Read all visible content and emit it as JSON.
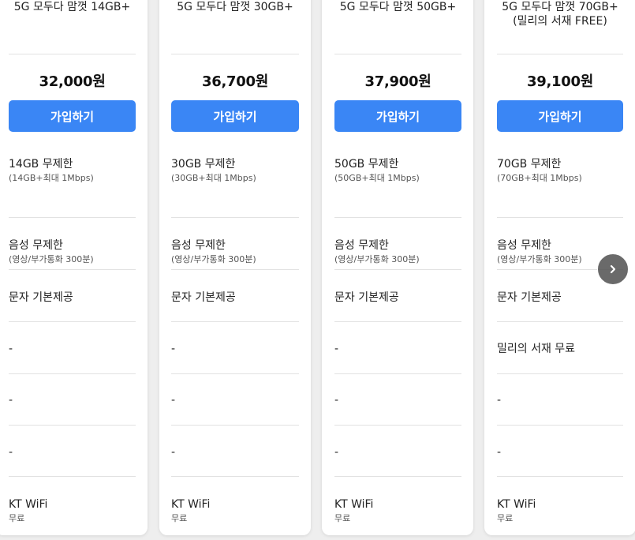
{
  "plans": [
    {
      "name": "5G 모두다 맘껏 14GB+",
      "price": "32,000원",
      "join_label": "가입하기",
      "data": {
        "main": "14GB 무제한",
        "sub": "(14GB+최대 1Mbps)"
      },
      "voice": {
        "main": "음성 무제한",
        "sub": "(영상/부가통화 300분)"
      },
      "sms": "문자 기본제공",
      "extra1": "-",
      "extra2": "-",
      "extra3": "-",
      "wifi": {
        "main": "KT WiFi",
        "sub": "무료"
      }
    },
    {
      "name": "5G 모두다 맘껏 30GB+",
      "price": "36,700원",
      "join_label": "가입하기",
      "data": {
        "main": "30GB 무제한",
        "sub": "(30GB+최대 1Mbps)"
      },
      "voice": {
        "main": "음성 무제한",
        "sub": "(영상/부가통화 300분)"
      },
      "sms": "문자 기본제공",
      "extra1": "-",
      "extra2": "-",
      "extra3": "-",
      "wifi": {
        "main": "KT WiFi",
        "sub": "무료"
      }
    },
    {
      "name": "5G 모두다 맘껏 50GB+",
      "price": "37,900원",
      "join_label": "가입하기",
      "data": {
        "main": "50GB 무제한",
        "sub": "(50GB+최대 1Mbps)"
      },
      "voice": {
        "main": "음성 무제한",
        "sub": "(영상/부가통화 300분)"
      },
      "sms": "문자 기본제공",
      "extra1": "-",
      "extra2": "-",
      "extra3": "-",
      "wifi": {
        "main": "KT WiFi",
        "sub": "무료"
      }
    },
    {
      "name": "5G 모두다 맘껏 70GB+\n(밀리의 서재 FREE)",
      "price": "39,100원",
      "join_label": "가입하기",
      "data": {
        "main": "70GB 무제한",
        "sub": "(70GB+최대 1Mbps)"
      },
      "voice": {
        "main": "음성 무제한",
        "sub": "(영상/부가통화 300분)"
      },
      "sms": "문자 기본제공",
      "extra1": "밀리의 서재 무료",
      "extra2": "-",
      "extra3": "-",
      "wifi": {
        "main": "KT WiFi",
        "sub": "무료"
      }
    }
  ],
  "next_button": {
    "icon": "chevron-right-icon"
  },
  "colors": {
    "button": "#3a86f5",
    "background": "#eeeeee",
    "card": "#ffffff"
  }
}
